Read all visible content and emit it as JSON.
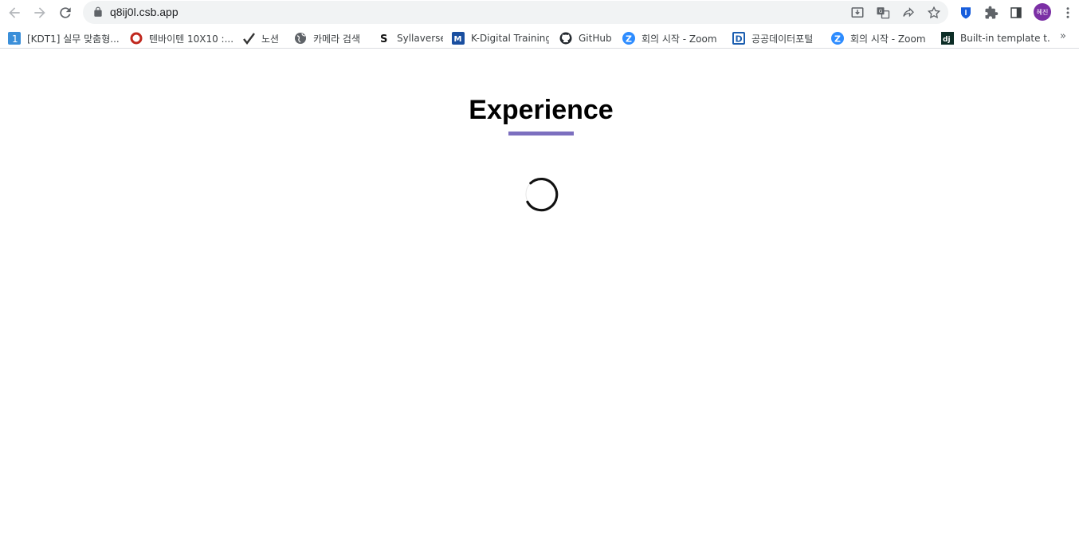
{
  "browser": {
    "url": "q8ij0l.csb.app",
    "profile_initials": "혜진",
    "bookmarks": [
      {
        "label": "[KDT1] 실무 맞춤형...",
        "icon": "number-one-icon"
      },
      {
        "label": "텐바이텐 10X10 :...",
        "icon": "ring-icon"
      },
      {
        "label": "노션",
        "icon": "checkmark-icon"
      },
      {
        "label": "카메라 검색",
        "icon": "globe-icon"
      },
      {
        "label": "Syllaverse",
        "icon": "letter-s-icon"
      },
      {
        "label": "K-Digital Training",
        "icon": "letter-m-icon"
      },
      {
        "label": "GitHub",
        "icon": "github-icon"
      },
      {
        "label": "회의 시작 - Zoom",
        "icon": "zoom-icon"
      },
      {
        "label": "공공데이터포털",
        "icon": "letter-d-icon"
      },
      {
        "label": "회의 시작 - Zoom",
        "icon": "zoom-icon"
      },
      {
        "label": "Built-in template t...",
        "icon": "django-icon"
      }
    ],
    "more_bookmarks": "»"
  },
  "page": {
    "heading": "Experience",
    "accent_color": "#7c6fbf",
    "loading": true
  }
}
